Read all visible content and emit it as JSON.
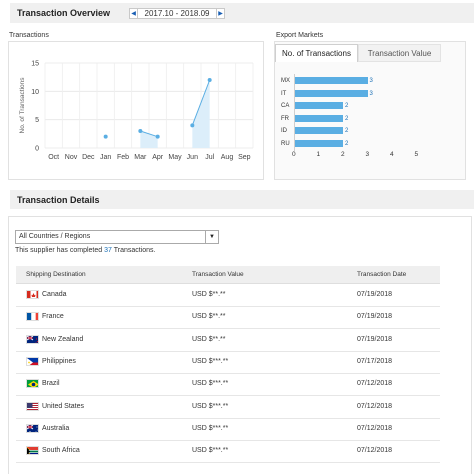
{
  "overview": {
    "title": "Transaction Overview",
    "prev_arrow": "◀",
    "next_arrow": "▶",
    "date_range": "2017.10 - 2018.09"
  },
  "transactions_chart": {
    "panel_label": "Transactions"
  },
  "chart_data": [
    {
      "type": "line",
      "ylabel": "No. of Transactions",
      "x": [
        "Oct",
        "Nov",
        "Dec",
        "Jan",
        "Feb",
        "Mar",
        "Apr",
        "May",
        "Jun",
        "Jul",
        "Aug",
        "Sep"
      ],
      "values": [
        null,
        null,
        null,
        2,
        null,
        3,
        2,
        null,
        4,
        12,
        null,
        null
      ],
      "ylim": [
        0,
        15
      ],
      "yticks": [
        "0",
        "5",
        "10",
        "15"
      ],
      "grid": true,
      "accent": "#5aaee3"
    },
    {
      "type": "bar",
      "orientation": "horizontal",
      "categories": [
        "MX",
        "IT",
        "CA",
        "FR",
        "ID",
        "RU"
      ],
      "values": [
        3,
        3,
        2,
        2,
        2,
        2
      ],
      "xlim": [
        0,
        5
      ],
      "xticks": [
        "0",
        "1",
        "2",
        "3",
        "4",
        "5"
      ],
      "bar_color": "#5aaee3"
    }
  ],
  "export_markets": {
    "panel_label": "Export Markets",
    "tabs": [
      {
        "label": "No. of Transactions",
        "active": true
      },
      {
        "label": "Transaction Value",
        "active": false
      }
    ]
  },
  "details": {
    "title": "Transaction Details",
    "filter_value": "All Countries / Regions",
    "summary_prefix": "This supplier has completed ",
    "summary_count": "37",
    "summary_suffix": " Transactions.",
    "columns": [
      "Shipping Destination",
      "Transaction Value",
      "Transaction Date"
    ],
    "rows": [
      {
        "country": "Canada",
        "flag": "canada-flag",
        "value": "USD $**.**",
        "date": "07/19/2018"
      },
      {
        "country": "France",
        "flag": "france-flag",
        "value": "USD $**.**",
        "date": "07/19/2018"
      },
      {
        "country": "New Zealand",
        "flag": "new-zealand-flag",
        "value": "USD $**.**",
        "date": "07/19/2018"
      },
      {
        "country": "Philippines",
        "flag": "philippines-flag",
        "value": "USD $***.**",
        "date": "07/17/2018"
      },
      {
        "country": "Brazil",
        "flag": "brazil-flag",
        "value": "USD $***.**",
        "date": "07/12/2018"
      },
      {
        "country": "United States",
        "flag": "united-states-flag",
        "value": "USD $***.**",
        "date": "07/12/2018"
      },
      {
        "country": "Australia",
        "flag": "australia-flag",
        "value": "USD $***.**",
        "date": "07/12/2018"
      },
      {
        "country": "South Africa",
        "flag": "south-africa-flag",
        "value": "USD $***.**",
        "date": "07/12/2018"
      }
    ]
  }
}
